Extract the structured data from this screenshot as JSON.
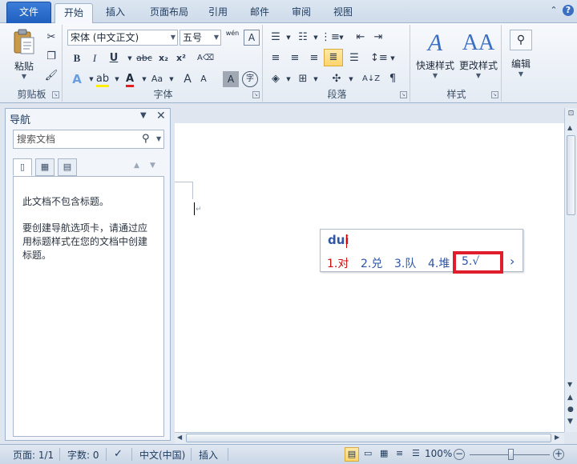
{
  "tabs": [
    "文件",
    "开始",
    "插入",
    "页面布局",
    "引用",
    "邮件",
    "审阅",
    "视图"
  ],
  "window": {
    "help_icon": "?"
  },
  "ribbon": {
    "clipboard": {
      "label": "剪贴板",
      "paste_label": "粘贴"
    },
    "font": {
      "label": "字体",
      "font_name": "宋体 (中文正文)",
      "font_size": "五号",
      "bold": "B",
      "italic": "I",
      "underline": "U",
      "strike": "abc",
      "subscript": "x₂",
      "superscript": "x²",
      "wen": "wén",
      "aa": "Aa",
      "grow": "A",
      "shrink": "A",
      "char_shade": "A",
      "encircle": "字"
    },
    "paragraph": {
      "label": "段落"
    },
    "styles": {
      "label": "样式",
      "quick": "快速样式",
      "change": "更改样式"
    },
    "editing": {
      "label": "编辑"
    }
  },
  "nav": {
    "title": "导航",
    "search_placeholder": "搜索文档",
    "message1": "此文档不包含标题。",
    "message2": "要创建导航选项卡，请通过应用标题样式在您的文档中创建标题。"
  },
  "ime": {
    "pinyin": "dui",
    "candidates": [
      {
        "label": "1.对",
        "color": "#cc1010"
      },
      {
        "label": "2.兑",
        "color": "#2f55a4"
      },
      {
        "label": "3.队",
        "color": "#2f55a4"
      },
      {
        "label": "4.堆",
        "color": "#2f55a4"
      },
      {
        "label": "5.√",
        "color": "#2f55a4"
      }
    ],
    "next": "›"
  },
  "status": {
    "page": "页面: 1/1",
    "words": "字数: 0",
    "language": "中文(中国)",
    "mode": "插入",
    "zoom": "100%"
  }
}
